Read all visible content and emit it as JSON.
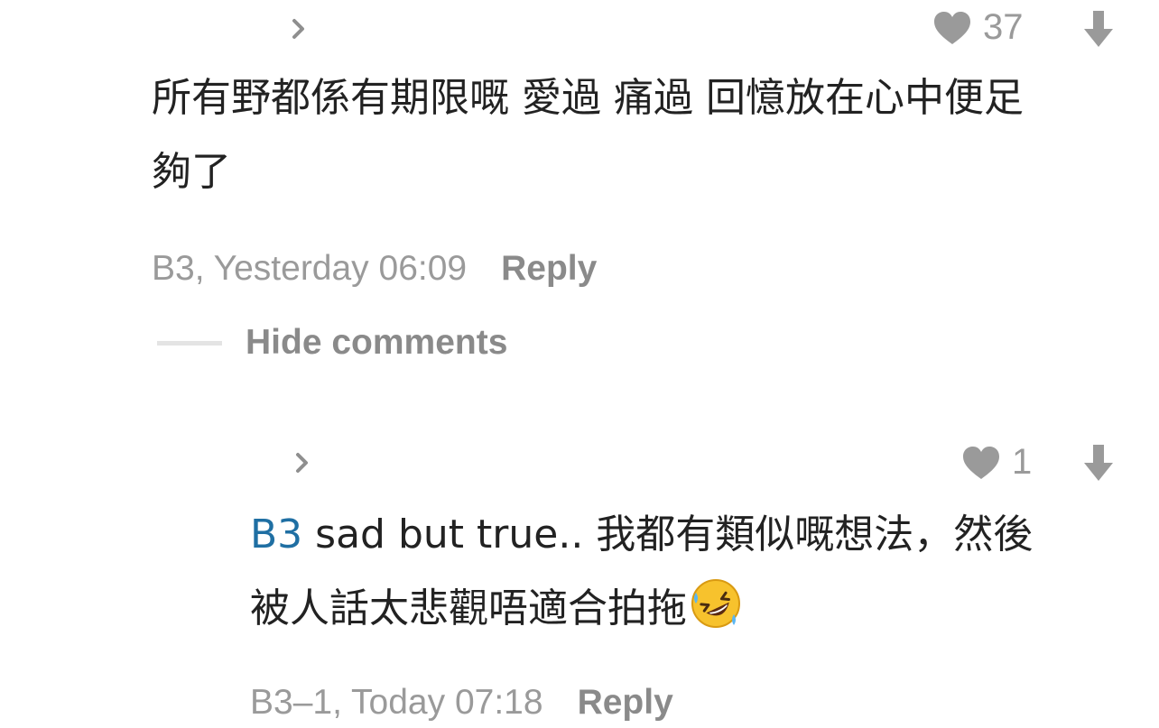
{
  "comments": [
    {
      "likes": "37",
      "text": "所有野都係有期限嘅 愛過 痛過 回憶放在心中便足夠了",
      "line1": "所有野都係有期限嘅 愛過 痛過 回憶放在心中便足",
      "line2": "夠了",
      "stamp": "B3, Yesterday 06:09",
      "reply_label": "Reply"
    },
    {
      "likes": "1",
      "mention": "B3",
      "line1_rest": " sad but true.. 我都有類似嘅想法，然後",
      "line2": "被人話太悲觀唔適合拍拖",
      "emoji_icon": "rolling-on-floor-laughing",
      "stamp": "B3–1, Today 07:18",
      "reply_label": "Reply"
    }
  ],
  "thread": {
    "hide_label": "Hide comments"
  },
  "colors": {
    "text": "#222222",
    "meta": "#9a9a9a",
    "mention": "#1f6fa3",
    "icon": "#9a9a9a"
  }
}
